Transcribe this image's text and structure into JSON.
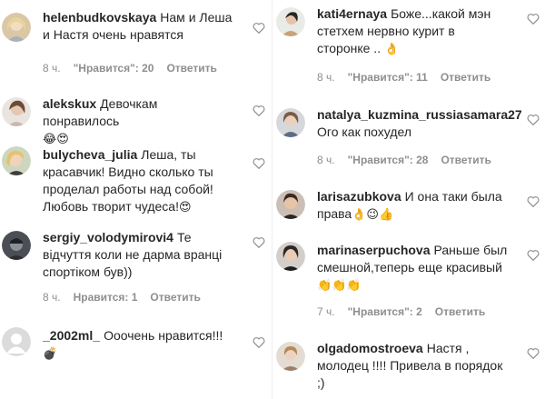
{
  "colors": {
    "text": "#262626",
    "meta": "#8e8e8e",
    "divider": "#efefef"
  },
  "left_comments": [
    {
      "username": "helenbudkovskaya",
      "text": "Нам и Леша и Настя очень нравятся",
      "time": "8 ч.",
      "likes": "\"Нравится\": 20",
      "reply": "Ответить",
      "emojis": []
    },
    {
      "username": "alekskux",
      "text": "Девочкам понравилось",
      "time": "",
      "likes": "",
      "reply": "",
      "emojis": [
        "😂",
        "😍"
      ]
    },
    {
      "username": "bulycheva_julia",
      "text": "Леша, ты красавчик! Видно сколько ты проделал работы над собой! Любовь творит чудеса!",
      "time": "",
      "likes": "",
      "reply": "",
      "emojis": [
        "😍"
      ]
    },
    {
      "username": "sergiy_volodymirovi4",
      "text": "Те відчуття коли не дарма вранці спортіком був))",
      "time": "8 ч.",
      "likes": "Нравится: 1",
      "reply": "Ответить",
      "emojis": []
    },
    {
      "username": "_2002ml_",
      "text": "Ооочень нравится!!!",
      "time": "",
      "likes": "",
      "reply": "",
      "emojis": [
        "💣"
      ]
    }
  ],
  "right_comments": [
    {
      "username": "kati4ernaya",
      "text": "Боже...какой мэн стетхем нервно курит в сторонке ..",
      "time": "8 ч.",
      "likes": "\"Нравится\": 11",
      "reply": "Ответить",
      "emojis": [
        "👌"
      ]
    },
    {
      "username": "natalya_kuzmina_russiasamara27",
      "text": "Ого как похудел",
      "time": "8 ч.",
      "likes": "\"Нравится\": 28",
      "reply": "Ответить",
      "emojis": []
    },
    {
      "username": "larisazubkova",
      "text": "И она таки была права",
      "time": "",
      "likes": "",
      "reply": "",
      "emojis": [
        "👌",
        "😉",
        "👍"
      ]
    },
    {
      "username": "marinaserpuchova",
      "text": "Раньше был смешной,теперь еще красивый",
      "time": "7 ч.",
      "likes": "\"Нравится\": 2",
      "reply": "Ответить",
      "emojis": [
        "👏",
        "👏",
        "👏"
      ]
    },
    {
      "username": "olgadomostroeva",
      "text": "Настя , молодец !!!! Привела в порядок ;)",
      "time": "",
      "likes": "",
      "reply": "",
      "emojis": []
    }
  ]
}
